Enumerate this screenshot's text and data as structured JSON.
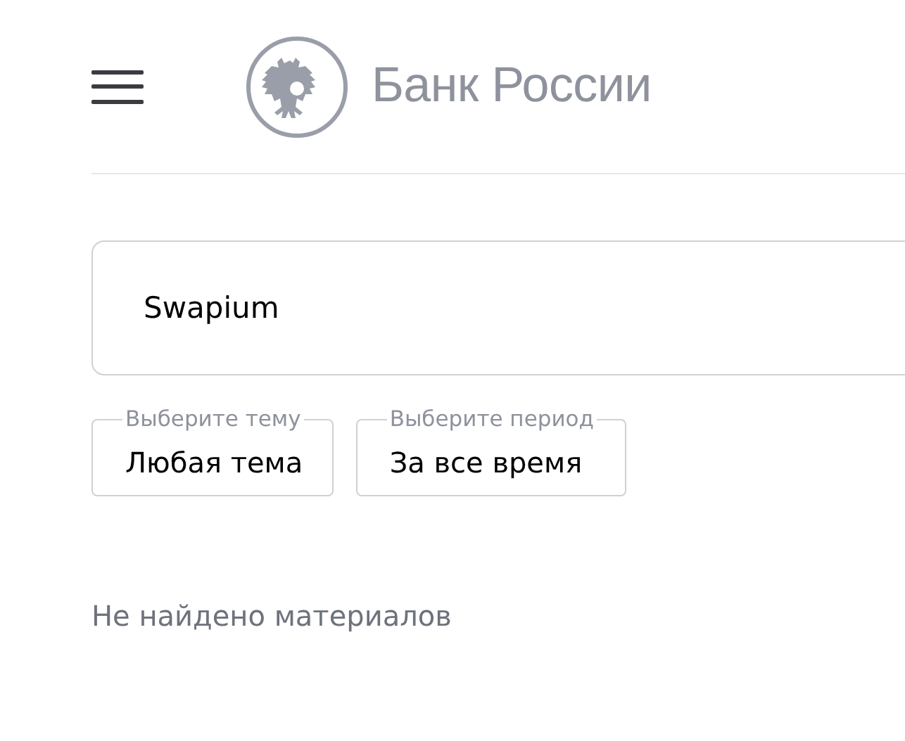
{
  "header": {
    "logo_text": "Банк России"
  },
  "search": {
    "value": "Swapium"
  },
  "filters": [
    {
      "label": "Выберите тему",
      "value": "Любая тема"
    },
    {
      "label": "Выберите период",
      "value": "За все время"
    }
  ],
  "message": "Не найдено материалов"
}
